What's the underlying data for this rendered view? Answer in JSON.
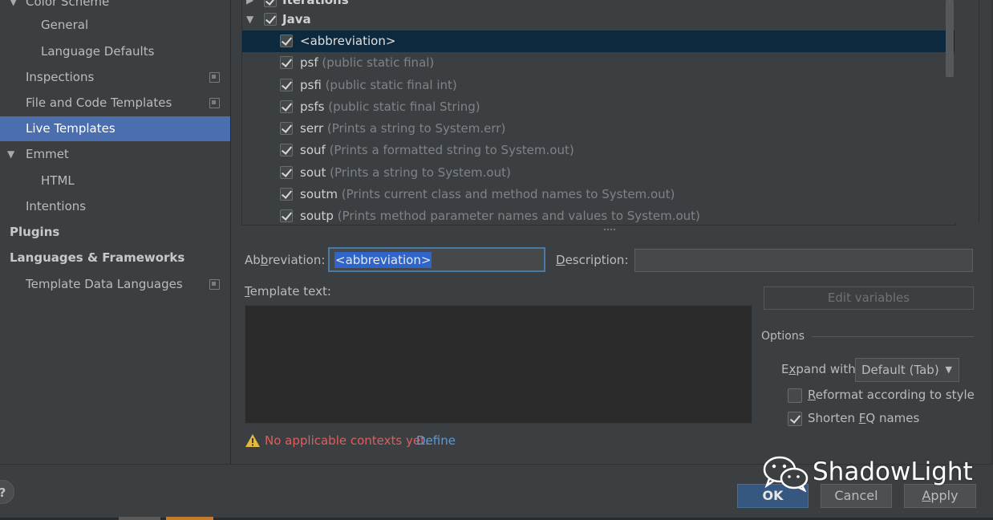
{
  "sidebar": {
    "items": [
      {
        "label": "Color Scheme"
      },
      {
        "label": "General"
      },
      {
        "label": "Language Defaults"
      },
      {
        "label": "Inspections"
      },
      {
        "label": "File and Code Templates"
      },
      {
        "label": "Live Templates"
      },
      {
        "label": "Emmet"
      },
      {
        "label": "HTML"
      },
      {
        "label": "Intentions"
      },
      {
        "label": "Plugins"
      },
      {
        "label": "Languages & Frameworks"
      },
      {
        "label": "Template Data Languages"
      }
    ]
  },
  "tree": {
    "groups": [
      {
        "label": "Iterations"
      },
      {
        "label": "Java"
      }
    ],
    "templates": [
      {
        "name": "<abbreviation>",
        "desc": ""
      },
      {
        "name": "psf",
        "desc": "(public static final)"
      },
      {
        "name": "psfi",
        "desc": "(public static final int)"
      },
      {
        "name": "psfs",
        "desc": "(public static final String)"
      },
      {
        "name": "serr",
        "desc": "(Prints a string to System.err)"
      },
      {
        "name": "souf",
        "desc": "(Prints a formatted string to System.out)"
      },
      {
        "name": "sout",
        "desc": "(Prints a string to System.out)"
      },
      {
        "name": "soutm",
        "desc": "(Prints current class and method names to System.out)"
      },
      {
        "name": "soutp",
        "desc": "(Prints method parameter names and values to System.out)"
      }
    ]
  },
  "editor": {
    "abbreviation_label_pre": "Ab",
    "abbreviation_label_key": "b",
    "abbreviation_label_post": "reviation:",
    "abbreviation_value": "<abbreviation>",
    "description_label_key": "D",
    "description_label_post": "escription:",
    "template_text_label_key": "T",
    "template_text_label_post": "emplate text:",
    "edit_variables": "Edit variables",
    "options_title": "Options",
    "expand_with_pre": "E",
    "expand_with_key": "x",
    "expand_with_post": "pand with",
    "expand_with_value": "Default (Tab)",
    "reformat_key": "R",
    "reformat_post": "eformat according to style",
    "shorten_pre": "Shorten ",
    "shorten_key": "F",
    "shorten_post": "Q names",
    "warning_text": "No applicable contexts yet.",
    "define_link": "Define"
  },
  "buttons": {
    "help": "?",
    "ok": "OK",
    "cancel": "Cancel",
    "apply_key": "A",
    "apply_post": "pply"
  },
  "watermark": {
    "text": "ShadowLight"
  },
  "colors": {
    "selection": "#4b6eaf",
    "tree_selection": "#0d293e",
    "warning": "#e05d5d",
    "link": "#5a9bd8"
  }
}
